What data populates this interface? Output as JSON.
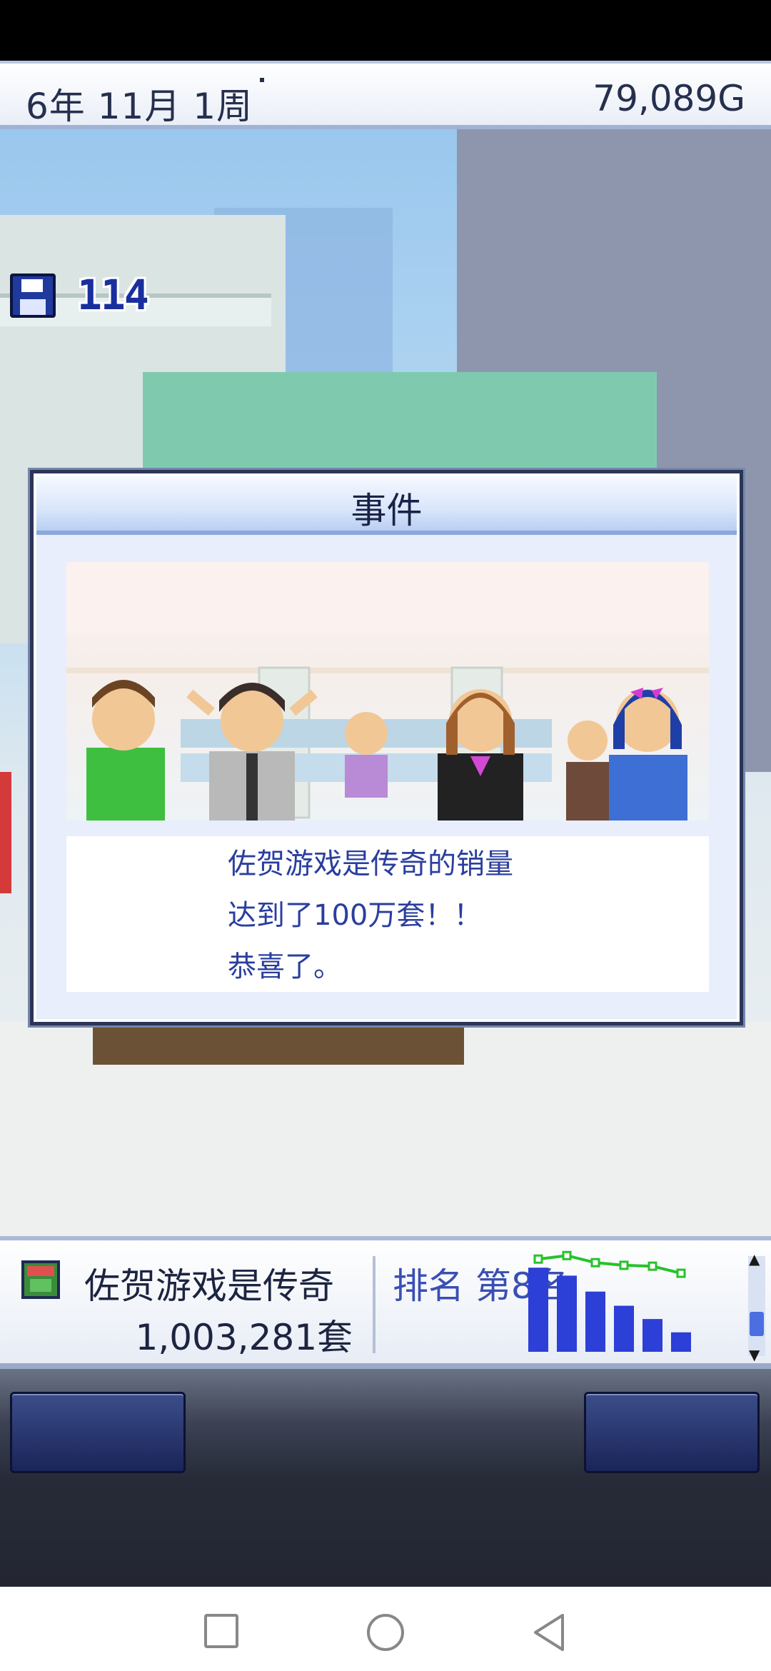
{
  "header": {
    "date": "6年 11月 1周",
    "money": "79,089G"
  },
  "save": {
    "count": "114"
  },
  "event_dialog": {
    "title": "事件",
    "message_lines": [
      "佐贺游戏是传奇的销量",
      "达到了100万套！！",
      "恭喜了。"
    ]
  },
  "info_bar": {
    "game_name": "佐贺游戏是传奇",
    "sales": "1,003,281套",
    "rank": "排名 第8名",
    "sales_chart": {
      "bars": [
        0.95,
        0.86,
        0.68,
        0.52,
        0.37,
        0.22
      ],
      "line": [
        0.95,
        0.99,
        0.91,
        0.88,
        0.87,
        0.79
      ],
      "bar_color": "#2c3fd6",
      "line_color": "#27c22a"
    }
  },
  "colors": {
    "dialog_border": "#2b3557",
    "message_text": "#2a3e9e",
    "rank_text": "#3a4fb3"
  }
}
